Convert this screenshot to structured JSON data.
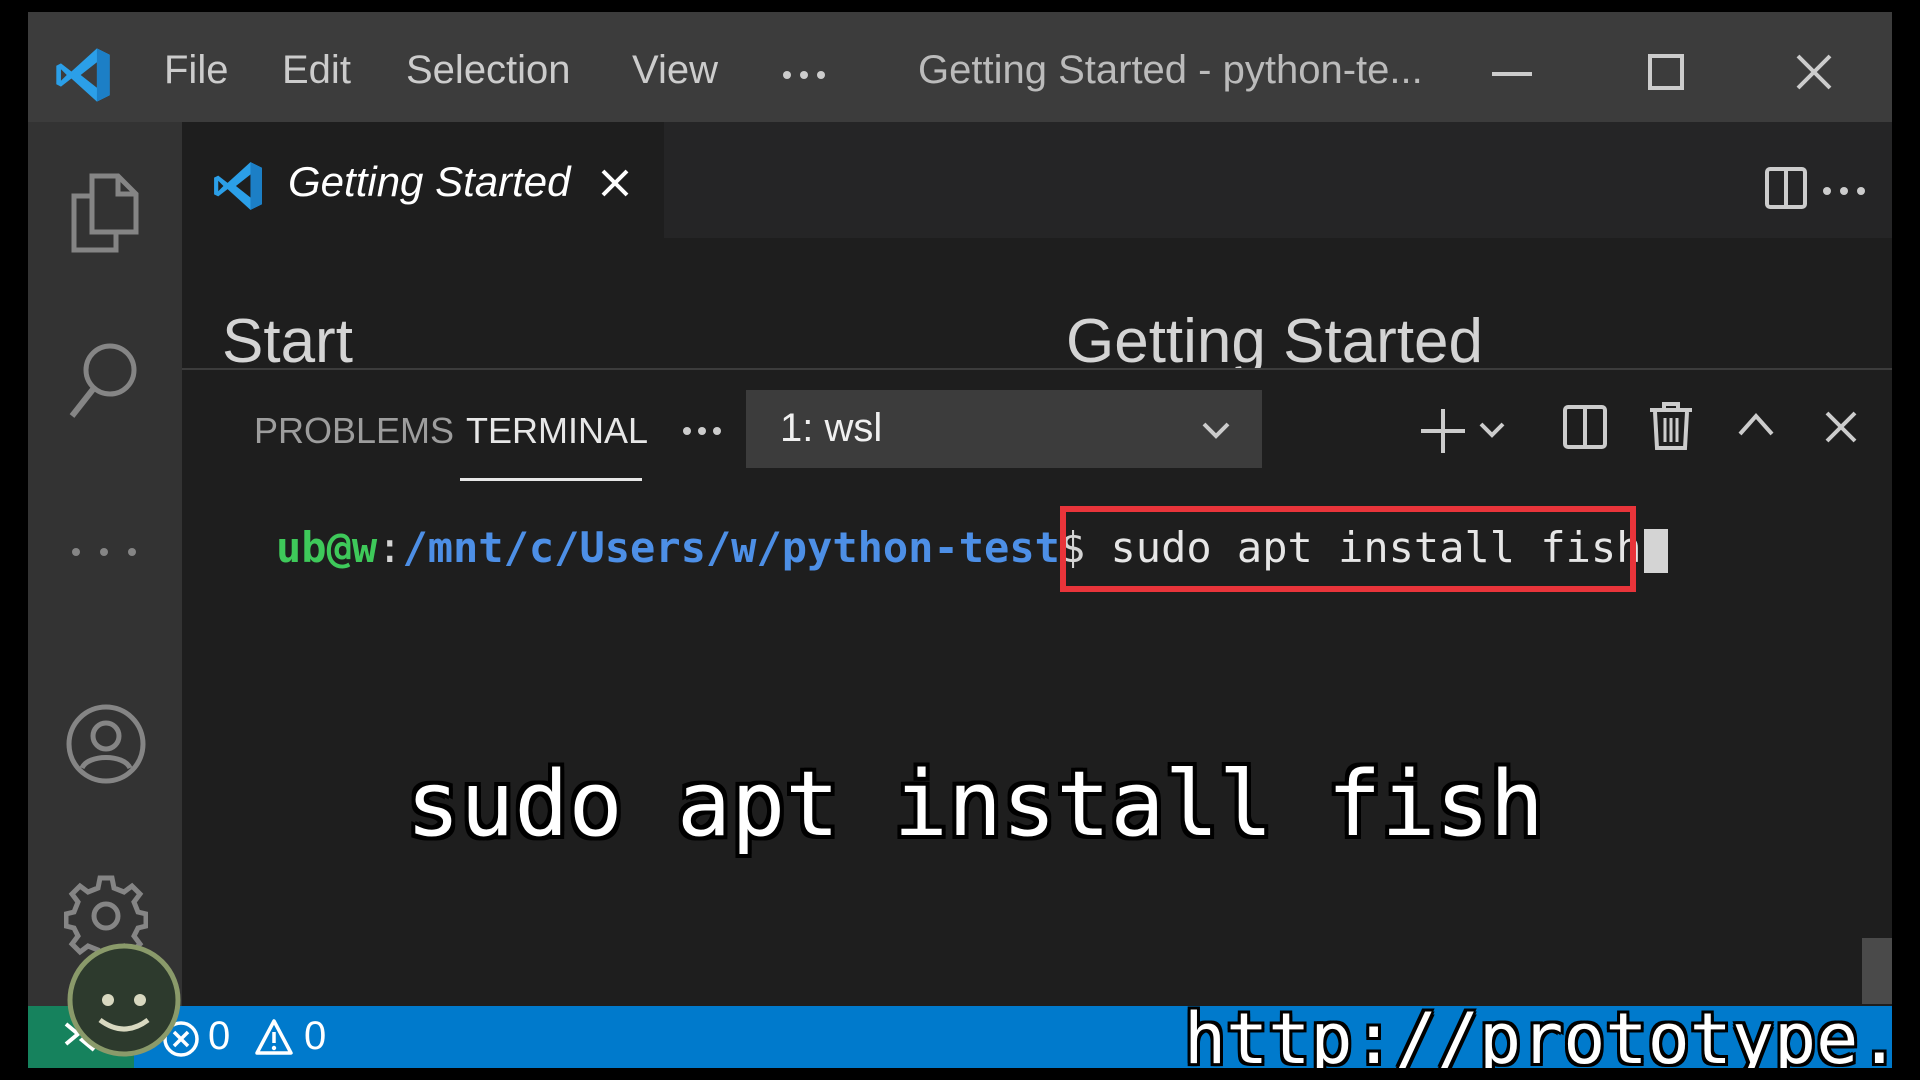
{
  "titlebar": {
    "menu": [
      "File",
      "Edit",
      "Selection",
      "View"
    ],
    "more": "···",
    "window_title": "Getting Started - python-te..."
  },
  "editor": {
    "tab_label": "Getting Started",
    "start_heading": "Start",
    "page_heading": "Getting Started"
  },
  "panel": {
    "tabs": [
      "PROBLEMS",
      "TERMINAL"
    ],
    "active_tab": "TERMINAL",
    "more": "···",
    "terminal_selector": "1: wsl"
  },
  "terminal": {
    "user": "ub@w",
    "separator": ":",
    "path": "/mnt/c/Users/w/python-test",
    "prompt": "$",
    "command": "sudo apt install fish"
  },
  "caption": "sudo apt install fish",
  "statusbar": {
    "errors": "0",
    "warnings": "0"
  },
  "watermark": {
    "url": "http://prototype.tel",
    "badge_text": "prototype.tel"
  },
  "icons": {
    "activity": [
      "explorer-icon",
      "search-icon",
      "more-icon",
      "accounts-icon",
      "settings-icon"
    ]
  },
  "colors": {
    "titlebar": "#3c3c3c",
    "activitybar": "#333333",
    "editor": "#1e1e1e",
    "statusbar": "#007acc",
    "remote": "#16825d",
    "highlight": "#e8343a",
    "prompt_user": "#3ec95a",
    "prompt_path": "#4d8fe6"
  }
}
